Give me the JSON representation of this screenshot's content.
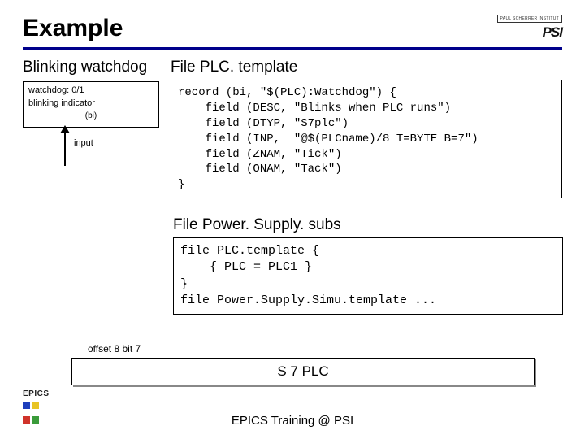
{
  "title": "Example",
  "psi": {
    "small": "PAUL SCHERRER INSTITUT",
    "big": "PSI"
  },
  "left": {
    "heading": "Blinking watchdog",
    "box_l1": "watchdog: 0/1",
    "box_l2": "blinking indicator",
    "box_l3": "(bi)",
    "input": "input"
  },
  "file1": {
    "label": "File PLC. template",
    "code": "record (bi, \"$(PLC):Watchdog\") {\n    field (DESC, \"Blinks when PLC runs\")\n    field (DTYP, \"S7plc\")\n    field (INP,  \"@$(PLCname)/8 T=BYTE B=7\")\n    field (ZNAM, \"Tick\")\n    field (ONAM, \"Tack\")\n}"
  },
  "file2": {
    "label": "File Power. Supply. subs",
    "code": "file PLC.template {\n    { PLC = PLC1 }\n}\nfile Power.Supply.Simu.template ..."
  },
  "offset": "offset 8 bit 7",
  "plc_box": "S 7 PLC",
  "footer": "EPICS Training @ PSI",
  "epics": "EPICS"
}
